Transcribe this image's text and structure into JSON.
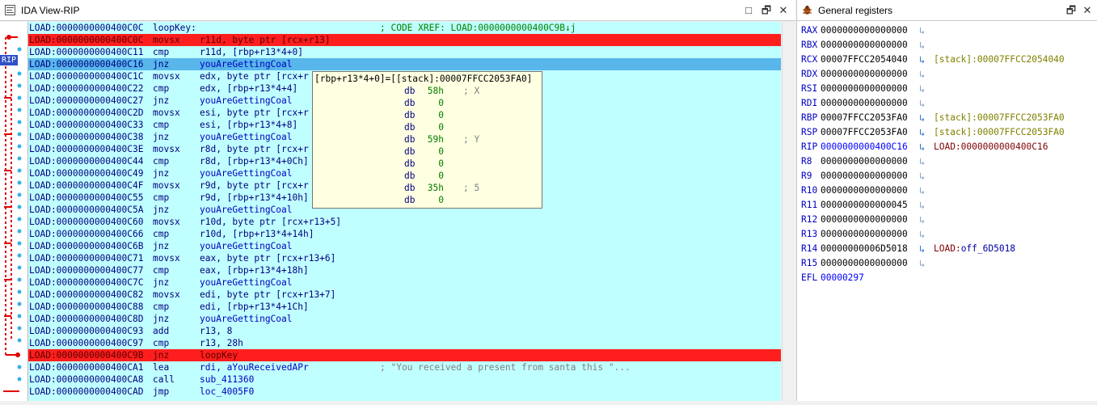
{
  "ida_view": {
    "title": "IDA View-RIP",
    "rip_badge": "RIP",
    "buttons": {
      "maximize": "□",
      "restore": "🗗",
      "close": "✕"
    }
  },
  "listing": [
    {
      "addr": "LOAD:0000000000400C0C",
      "mn": "loopKey:",
      "op": "",
      "cm": "; CODE XREF: LOAD:0000000000400C9B↓j",
      "style": "label"
    },
    {
      "addr": "LOAD:0000000000400C0C",
      "mn": "movsx",
      "op": "r11d, byte ptr [rcx+r13]",
      "cm": "",
      "style": "red"
    },
    {
      "addr": "LOAD:0000000000400C11",
      "mn": "cmp",
      "op": "r11d, [rbp+r13*4+0]",
      "cm": "",
      "style": ""
    },
    {
      "addr": "LOAD:0000000000400C16",
      "mn": "jnz",
      "op": "youAreGettingCoal",
      "cm": "",
      "style": "sel"
    },
    {
      "addr": "LOAD:0000000000400C1C",
      "mn": "movsx",
      "op": "edx, byte ptr [rcx+r",
      "cm": "",
      "style": ""
    },
    {
      "addr": "LOAD:0000000000400C22",
      "mn": "cmp",
      "op": "edx, [rbp+r13*4+4]",
      "cm": "",
      "style": ""
    },
    {
      "addr": "LOAD:0000000000400C27",
      "mn": "jnz",
      "op": "youAreGettingCoal",
      "cm": "",
      "style": ""
    },
    {
      "addr": "LOAD:0000000000400C2D",
      "mn": "movsx",
      "op": "esi, byte ptr [rcx+r",
      "cm": "",
      "style": ""
    },
    {
      "addr": "LOAD:0000000000400C33",
      "mn": "cmp",
      "op": "esi, [rbp+r13*4+8]",
      "cm": "",
      "style": ""
    },
    {
      "addr": "LOAD:0000000000400C38",
      "mn": "jnz",
      "op": "youAreGettingCoal",
      "cm": "",
      "style": ""
    },
    {
      "addr": "LOAD:0000000000400C3E",
      "mn": "movsx",
      "op": "r8d, byte ptr [rcx+r",
      "cm": "",
      "style": ""
    },
    {
      "addr": "LOAD:0000000000400C44",
      "mn": "cmp",
      "op": "r8d, [rbp+r13*4+0Ch]",
      "cm": "",
      "style": ""
    },
    {
      "addr": "LOAD:0000000000400C49",
      "mn": "jnz",
      "op": "youAreGettingCoal",
      "cm": "",
      "style": ""
    },
    {
      "addr": "LOAD:0000000000400C4F",
      "mn": "movsx",
      "op": "r9d, byte ptr [rcx+r",
      "cm": "",
      "style": ""
    },
    {
      "addr": "LOAD:0000000000400C55",
      "mn": "cmp",
      "op": "r9d, [rbp+r13*4+10h]",
      "cm": "",
      "style": ""
    },
    {
      "addr": "LOAD:0000000000400C5A",
      "mn": "jnz",
      "op": "youAreGettingCoal",
      "cm": "",
      "style": ""
    },
    {
      "addr": "LOAD:0000000000400C60",
      "mn": "movsx",
      "op": "r10d, byte ptr [rcx+r13+5]",
      "cm": "",
      "style": ""
    },
    {
      "addr": "LOAD:0000000000400C66",
      "mn": "cmp",
      "op": "r10d, [rbp+r13*4+14h]",
      "cm": "",
      "style": ""
    },
    {
      "addr": "LOAD:0000000000400C6B",
      "mn": "jnz",
      "op": "youAreGettingCoal",
      "cm": "",
      "style": ""
    },
    {
      "addr": "LOAD:0000000000400C71",
      "mn": "movsx",
      "op": "eax, byte ptr [rcx+r13+6]",
      "cm": "",
      "style": ""
    },
    {
      "addr": "LOAD:0000000000400C77",
      "mn": "cmp",
      "op": "eax, [rbp+r13*4+18h]",
      "cm": "",
      "style": ""
    },
    {
      "addr": "LOAD:0000000000400C7C",
      "mn": "jnz",
      "op": "youAreGettingCoal",
      "cm": "",
      "style": ""
    },
    {
      "addr": "LOAD:0000000000400C82",
      "mn": "movsx",
      "op": "edi, byte ptr [rcx+r13+7]",
      "cm": "",
      "style": ""
    },
    {
      "addr": "LOAD:0000000000400C88",
      "mn": "cmp",
      "op": "edi, [rbp+r13*4+1Ch]",
      "cm": "",
      "style": ""
    },
    {
      "addr": "LOAD:0000000000400C8D",
      "mn": "jnz",
      "op": "youAreGettingCoal",
      "cm": "",
      "style": ""
    },
    {
      "addr": "LOAD:0000000000400C93",
      "mn": "add",
      "op": "r13, 8",
      "cm": "",
      "style": ""
    },
    {
      "addr": "LOAD:0000000000400C97",
      "mn": "cmp",
      "op": "r13, 28h",
      "cm": "",
      "style": ""
    },
    {
      "addr": "LOAD:0000000000400C9B",
      "mn": "jnz",
      "op": "loopKey",
      "cm": "",
      "style": "red"
    },
    {
      "addr": "LOAD:0000000000400CA1",
      "mn": "lea",
      "op": "rdi, aYouReceivedAPr",
      "cm": "; \"You received a present from santa this \"...",
      "style": ""
    },
    {
      "addr": "LOAD:0000000000400CA8",
      "mn": "call",
      "op": "sub_411360",
      "cm": "",
      "style": ""
    },
    {
      "addr": "LOAD:0000000000400CAD",
      "mn": "jmp",
      "op": "loc_4005F0",
      "cm": "",
      "style": ""
    }
  ],
  "hint": {
    "header": "[rbp+r13*4+0]=[[stack]:00007FFCC2053FA0]",
    "rows": [
      {
        "d": "db",
        "v": "58h",
        "c": "; X"
      },
      {
        "d": "db",
        "v": "0",
        "c": ""
      },
      {
        "d": "db",
        "v": "0",
        "c": ""
      },
      {
        "d": "db",
        "v": "0",
        "c": ""
      },
      {
        "d": "db",
        "v": "59h",
        "c": "; Y"
      },
      {
        "d": "db",
        "v": "0",
        "c": ""
      },
      {
        "d": "db",
        "v": "0",
        "c": ""
      },
      {
        "d": "db",
        "v": "0",
        "c": ""
      },
      {
        "d": "db",
        "v": "35h",
        "c": "; 5"
      },
      {
        "d": "db",
        "v": "0",
        "c": ""
      }
    ]
  },
  "registers_view": {
    "title": "General registers",
    "buttons": {
      "restore": "🗗",
      "close": "✕"
    },
    "registers": [
      {
        "name": "RAX",
        "value": "0000000000000000",
        "target": "",
        "kind": ""
      },
      {
        "name": "RBX",
        "value": "0000000000000000",
        "target": "",
        "kind": ""
      },
      {
        "name": "RCX",
        "value": "00007FFCC2054040",
        "target": "[stack]:00007FFCC2054040",
        "kind": "stack"
      },
      {
        "name": "RDX",
        "value": "0000000000000000",
        "target": "",
        "kind": ""
      },
      {
        "name": "RSI",
        "value": "0000000000000000",
        "target": "",
        "kind": ""
      },
      {
        "name": "RDI",
        "value": "0000000000000000",
        "target": "",
        "kind": ""
      },
      {
        "name": "RBP",
        "value": "00007FFCC2053FA0",
        "target": "[stack]:00007FFCC2053FA0",
        "kind": "stack"
      },
      {
        "name": "RSP",
        "value": "00007FFCC2053FA0",
        "target": "[stack]:00007FFCC2053FA0",
        "kind": "stack"
      },
      {
        "name": "RIP",
        "value": "0000000000400C16",
        "target": "LOAD:0000000000400C16",
        "kind": "load",
        "changed": true
      },
      {
        "name": "R8",
        "value": "0000000000000000",
        "target": "",
        "kind": ""
      },
      {
        "name": "R9",
        "value": "0000000000000000",
        "target": "",
        "kind": ""
      },
      {
        "name": "R10",
        "value": "0000000000000000",
        "target": "",
        "kind": ""
      },
      {
        "name": "R11",
        "value": "0000000000000045",
        "target": "",
        "kind": ""
      },
      {
        "name": "R12",
        "value": "0000000000000000",
        "target": "",
        "kind": ""
      },
      {
        "name": "R13",
        "value": "0000000000000000",
        "target": "",
        "kind": ""
      },
      {
        "name": "R14",
        "value": "00000000006D5018",
        "target": "LOAD:off_6D5018",
        "kind": "loadfn"
      },
      {
        "name": "R15",
        "value": "0000000000000000",
        "target": "",
        "kind": ""
      },
      {
        "name": "EFL",
        "value": "00000297",
        "target": "",
        "kind": "",
        "noarrow": true,
        "changed": true
      }
    ]
  },
  "colors": {
    "listing_bg": "#c0ffff",
    "breakpoint": "#ff1e1e",
    "current": "#58b6ea",
    "hint_bg": "#ffffe1"
  }
}
